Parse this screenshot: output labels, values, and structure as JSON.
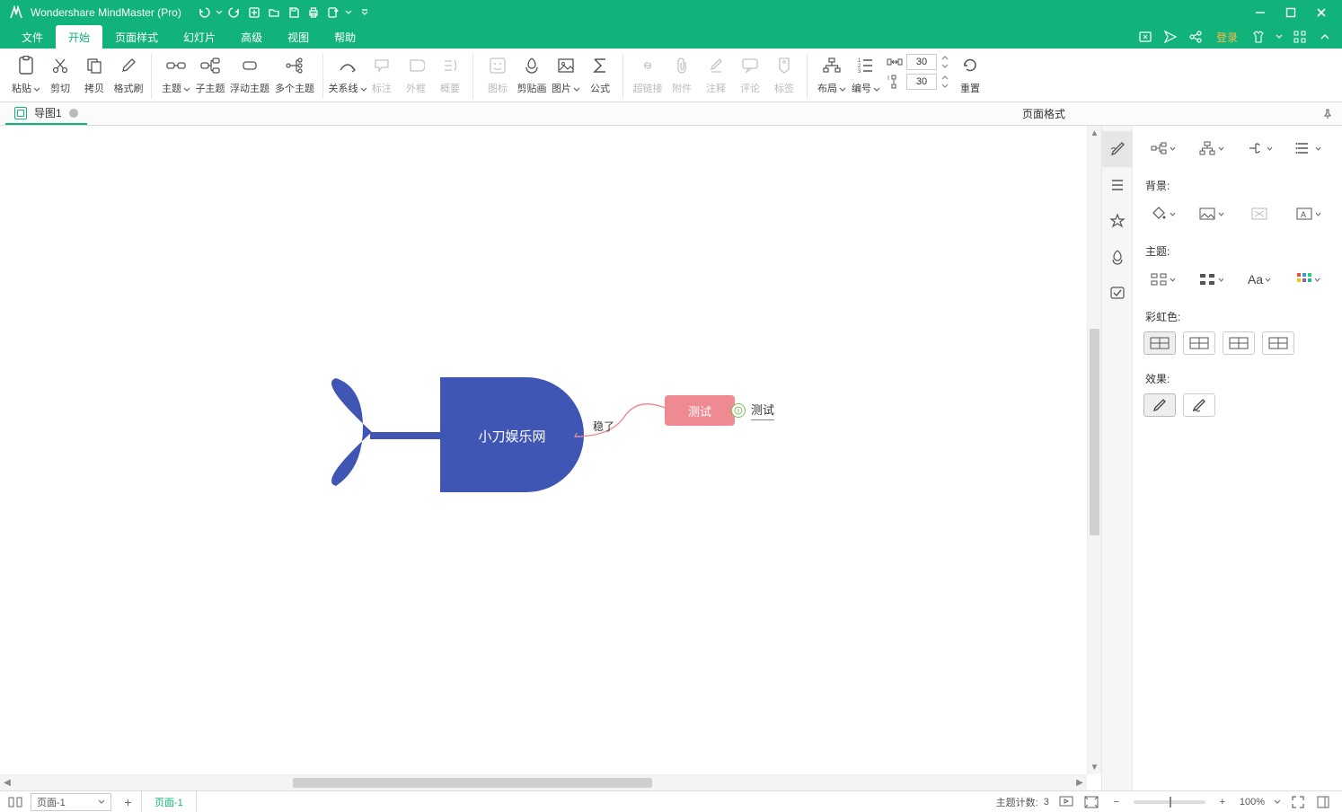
{
  "app": {
    "title": "Wondershare MindMaster (Pro)"
  },
  "menu": {
    "items": [
      "文件",
      "开始",
      "页面样式",
      "幻灯片",
      "高级",
      "视图",
      "帮助"
    ],
    "active_index": 1,
    "login": "登录"
  },
  "ribbon": {
    "paste": "粘贴",
    "cut": "剪切",
    "copy": "拷贝",
    "formatpainter": "格式刷",
    "topic": "主题",
    "subtopic": "子主题",
    "floattopic": "浮动主题",
    "multitopic": "多个主题",
    "relation": "关系线",
    "callout": "标注",
    "boundary": "外框",
    "summary": "概要",
    "icon": "图标",
    "clipart": "剪贴画",
    "picture": "图片",
    "formula": "公式",
    "hyperlink": "超链接",
    "attachment": "附件",
    "note": "注释",
    "comment": "评论",
    "tag": "标签",
    "layout": "布局",
    "numbering": "编号",
    "h_spacing": "30",
    "v_spacing": "30",
    "reset": "重置"
  },
  "doctab": {
    "name": "导图1"
  },
  "canvas": {
    "root_text": "小刀娱乐网",
    "edge_label": "稳了",
    "node2": "测试",
    "node3": "测试"
  },
  "panel": {
    "title": "页面格式",
    "bg_label": "背景:",
    "topic_label": "主题:",
    "rainbow_label": "彩虹色:",
    "effect_label": "效果:"
  },
  "status": {
    "page_selected": "页面-1",
    "page_tab": "页面-1",
    "topic_count_label": "主题计数:",
    "topic_count": "3",
    "zoom": "100%"
  }
}
